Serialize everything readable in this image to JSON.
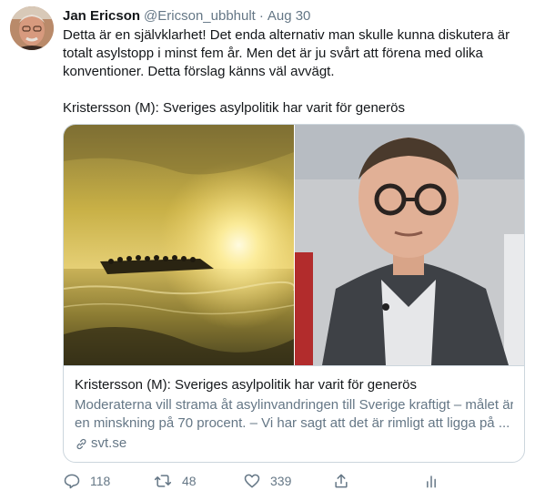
{
  "tweet": {
    "display_name": "Jan Ericson",
    "handle": "@Ericson_ubbhult",
    "separator": "·",
    "time": "Aug 30",
    "text_lines": [
      "Detta är en självklarhet! Det enda alternativ man skulle kunna diskutera är",
      "totalt asylstopp i minst fem år. Men det är ju svårt att förena med olika",
      "konventioner. Detta förslag känns väl avvägt."
    ],
    "link_headline": "Kristersson (M): Sveriges asylpolitik har varit för generös"
  },
  "card": {
    "title": "Kristersson (M): Sveriges asylpolitik har varit för generös",
    "description_lines": [
      "Moderaterna vill strama åt asylinvandringen till Sverige kraftigt – målet är",
      "en minskning på 70 procent. – Vi har sagt att det är rimligt att ligga på ..."
    ],
    "domain": "svt.se",
    "images": [
      "boat-at-sunset-photo",
      "man-with-glasses-photo"
    ]
  },
  "actions": {
    "replies": "118",
    "retweets": "48",
    "likes": "339",
    "icons": [
      "reply-icon",
      "retweet-icon",
      "like-icon",
      "share-icon",
      "analytics-icon"
    ]
  },
  "colors": {
    "text": "#14171a",
    "secondary": "#657786",
    "border": "#ccd6dd"
  }
}
